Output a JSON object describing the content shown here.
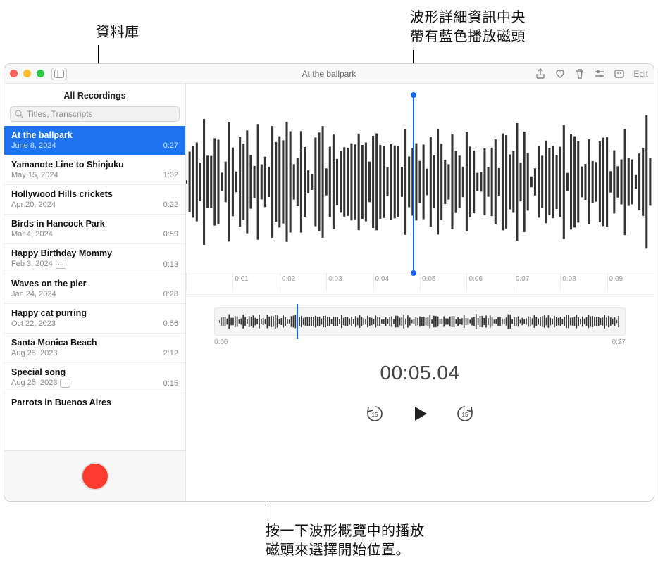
{
  "callouts": {
    "library": "資料庫",
    "playhead": "波形詳細資訊中央\n帶有藍色播放磁頭",
    "overview": "按一下波形概覽中的播放\n磁頭來選擇開始位置。"
  },
  "window": {
    "title": "At the ballpark",
    "edit": "Edit"
  },
  "sidebar": {
    "header": "All Recordings",
    "search_placeholder": "Titles, Transcripts",
    "items": [
      {
        "title": "At the ballpark",
        "date": "June 8, 2024",
        "dur": "0:27",
        "sel": true
      },
      {
        "title": "Yamanote Line to Shinjuku",
        "date": "May 15, 2024",
        "dur": "1:02"
      },
      {
        "title": "Hollywood Hills crickets",
        "date": "Apr 20, 2024",
        "dur": "0:22"
      },
      {
        "title": "Birds in Hancock Park",
        "date": "Mar 4, 2024",
        "dur": "0:59"
      },
      {
        "title": "Happy Birthday Mommy",
        "date": "Feb 3, 2024",
        "dur": "0:13",
        "badge": true
      },
      {
        "title": "Waves on the pier",
        "date": "Jan 24, 2024",
        "dur": "0:28"
      },
      {
        "title": "Happy cat purring",
        "date": "Oct 22, 2023",
        "dur": "0:56"
      },
      {
        "title": "Santa Monica Beach",
        "date": "Aug 25, 2023",
        "dur": "2:12"
      },
      {
        "title": "Special song",
        "date": "Aug 25, 2023",
        "dur": "0:15",
        "badge": true
      },
      {
        "title": "Parrots in Buenos Aires",
        "date": "",
        "dur": ""
      }
    ]
  },
  "timeline": [
    "0:01",
    "0:02",
    "0:03",
    "0:04",
    "0:05",
    "0:06",
    "0:07",
    "0:08",
    "0:09"
  ],
  "overview": {
    "start": "0:00",
    "end": "0:27"
  },
  "currentTime": "00:05.04",
  "waveformDetailBars": 130,
  "overviewBars": 200
}
